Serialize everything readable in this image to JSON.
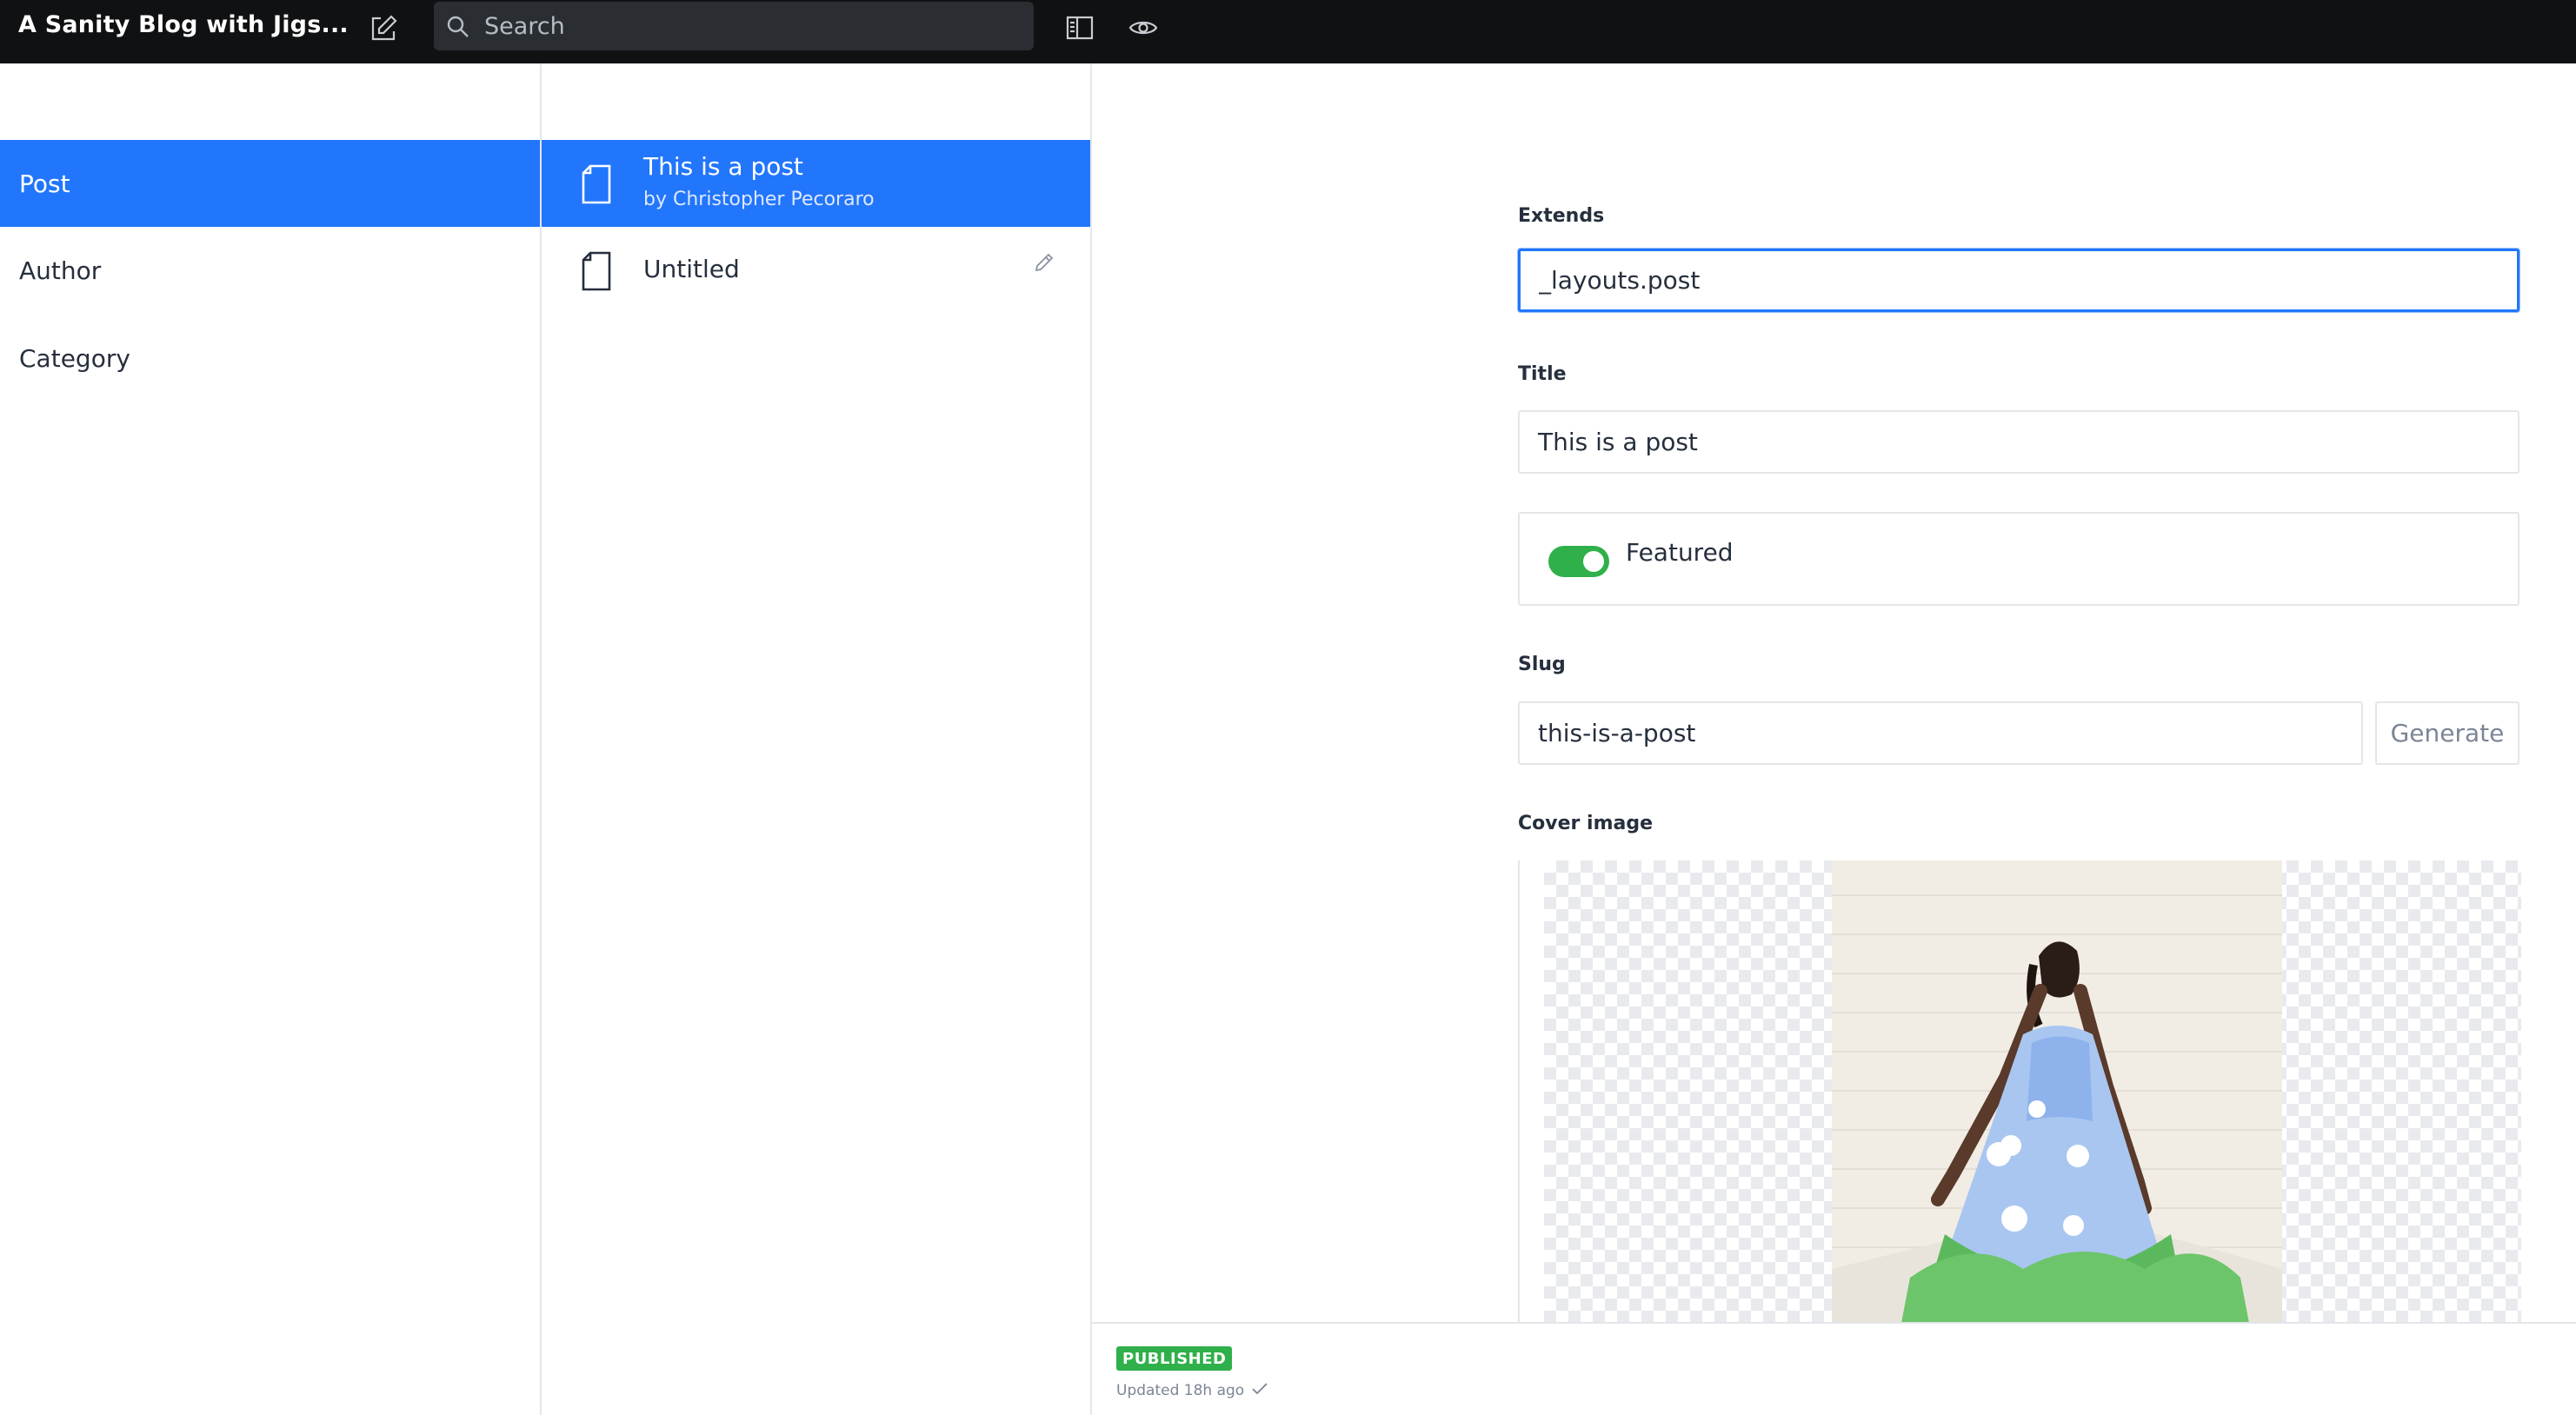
{
  "app": {
    "title": "A Sanity Blog with Jigs..."
  },
  "search": {
    "placeholder": "Search"
  },
  "types": [
    {
      "label": "Post",
      "active": true
    },
    {
      "label": "Author",
      "active": false
    },
    {
      "label": "Category",
      "active": false
    }
  ],
  "documents": [
    {
      "title": "This is a post",
      "subtitle": "by Christopher Pecoraro",
      "active": true
    },
    {
      "title": "Untitled",
      "subtitle": "",
      "active": false
    }
  ],
  "editor": {
    "extends": {
      "label": "Extends",
      "value": "_layouts.post"
    },
    "title": {
      "label": "Title",
      "value": "This is a post"
    },
    "featured": {
      "label": "Featured",
      "on": true
    },
    "slug": {
      "label": "Slug",
      "value": "this-is-a-post",
      "generate_label": "Generate"
    },
    "cover_image": {
      "label": "Cover image"
    }
  },
  "footer": {
    "status": "PUBLISHED",
    "updated": "Updated 18h ago"
  },
  "colors": {
    "accent": "#2276fc",
    "topbar": "#101112",
    "published": "#2fb04a"
  }
}
